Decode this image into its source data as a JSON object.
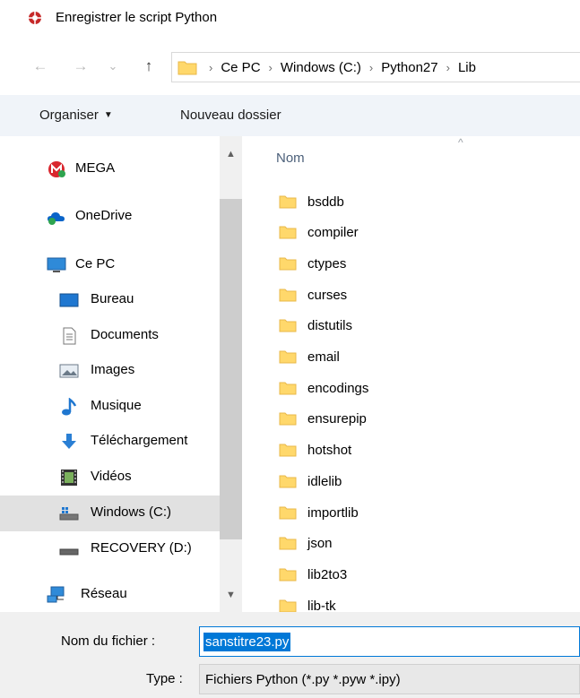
{
  "window": {
    "title": "Enregistrer le script Python",
    "icon": "python-script-icon"
  },
  "nav_buttons": {
    "back": "←",
    "forward": "→",
    "recent": "⌄",
    "up": "↑"
  },
  "breadcrumb": {
    "items": [
      "Ce PC",
      "Windows (C:)",
      "Python27",
      "Lib"
    ],
    "separator": "›"
  },
  "toolbar": {
    "organize_label": "Organiser",
    "organize_caret": "▼",
    "new_folder_label": "Nouveau dossier"
  },
  "navpane": {
    "items": [
      {
        "label": "MEGA",
        "icon": "mega-icon"
      },
      {
        "label": "OneDrive",
        "icon": "onedrive-icon"
      },
      {
        "label": "Ce PC",
        "icon": "computer-icon"
      },
      {
        "label": "Bureau",
        "icon": "desktop-icon"
      },
      {
        "label": "Documents",
        "icon": "documents-icon"
      },
      {
        "label": "Images",
        "icon": "images-icon"
      },
      {
        "label": "Musique",
        "icon": "music-icon"
      },
      {
        "label": "Téléchargement",
        "icon": "download-icon"
      },
      {
        "label": "Vidéos",
        "icon": "videos-icon"
      },
      {
        "label": "Windows (C:)",
        "icon": "drive-icon",
        "selected": true
      },
      {
        "label": "RECOVERY (D:)",
        "icon": "drive-icon"
      },
      {
        "label": "Réseau",
        "icon": "network-icon"
      }
    ]
  },
  "filelist": {
    "column_header": "Nom",
    "sort_indicator": "^",
    "items": [
      "bsddb",
      "compiler",
      "ctypes",
      "curses",
      "distutils",
      "email",
      "encodings",
      "ensurepip",
      "hotshot",
      "idlelib",
      "importlib",
      "json",
      "lib2to3",
      "lib-tk"
    ]
  },
  "form": {
    "filename_label": "Nom du fichier :",
    "filename_value": "sanstitre23.py",
    "type_label": "Type :",
    "type_value": "Fichiers Python (*.py *.pyw *.ipy)"
  },
  "colors": {
    "accent": "#0078d7",
    "folder": "#ffd86b",
    "folder_dark": "#e8b84a",
    "command_bar": "#f0f4f9"
  }
}
